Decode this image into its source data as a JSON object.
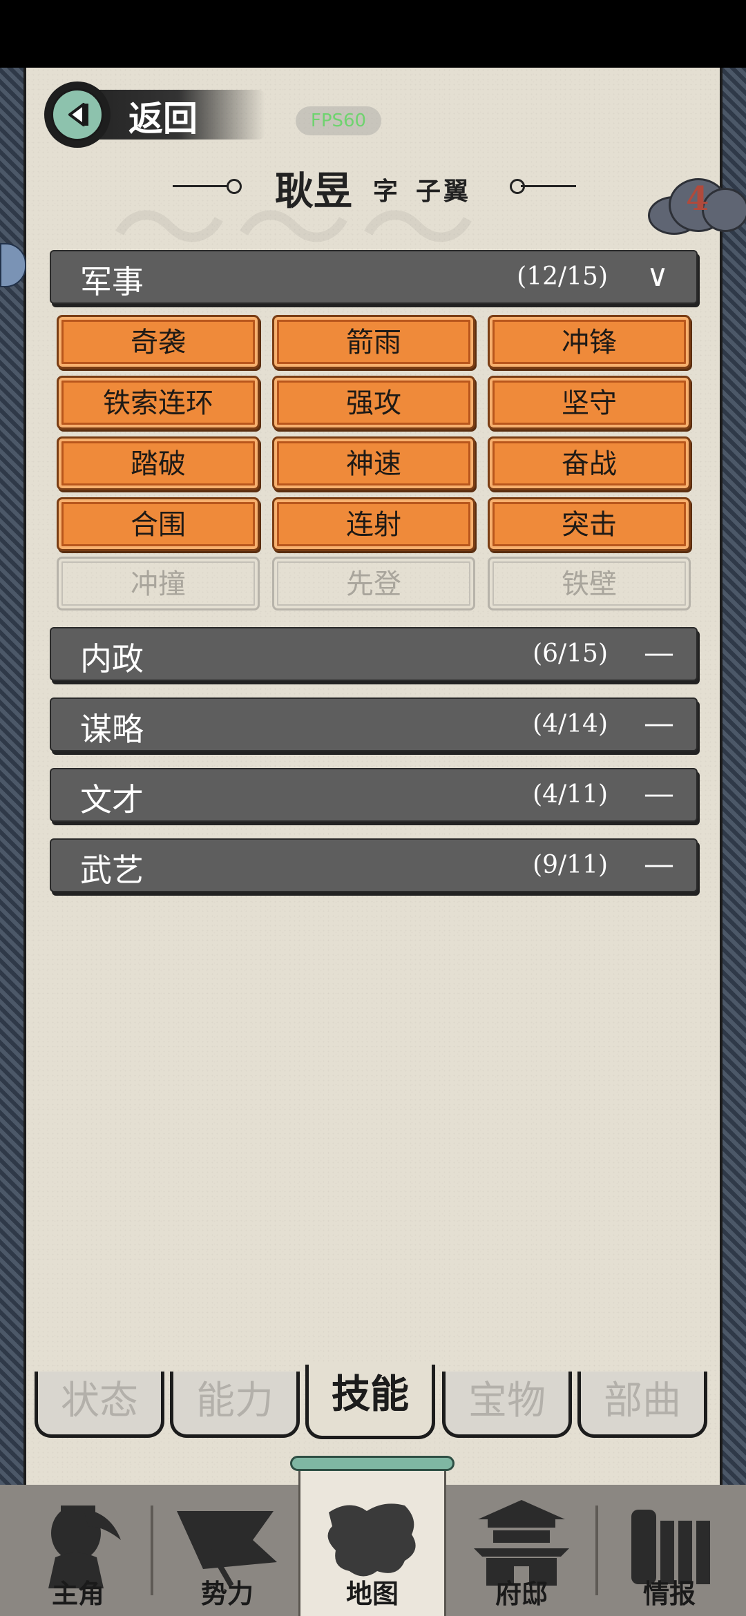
{
  "header": {
    "back_label": "返回",
    "fps": "FPS60",
    "character_name": "耿昱",
    "courtesy_label": "字",
    "courtesy_name": "子翼",
    "badge_count": "4"
  },
  "sections": [
    {
      "label": "军事",
      "count": "(12/15)",
      "expanded": true,
      "skills": [
        {
          "name": "奇袭",
          "unlocked": true
        },
        {
          "name": "箭雨",
          "unlocked": true
        },
        {
          "name": "冲锋",
          "unlocked": true
        },
        {
          "name": "铁索连环",
          "unlocked": true
        },
        {
          "name": "强攻",
          "unlocked": true
        },
        {
          "name": "坚守",
          "unlocked": true
        },
        {
          "name": "踏破",
          "unlocked": true
        },
        {
          "name": "神速",
          "unlocked": true
        },
        {
          "name": "奋战",
          "unlocked": true
        },
        {
          "name": "合围",
          "unlocked": true
        },
        {
          "name": "连射",
          "unlocked": true
        },
        {
          "name": "突击",
          "unlocked": true
        },
        {
          "name": "冲撞",
          "unlocked": false
        },
        {
          "name": "先登",
          "unlocked": false
        },
        {
          "name": "铁壁",
          "unlocked": false
        }
      ]
    },
    {
      "label": "内政",
      "count": "(6/15)",
      "expanded": false
    },
    {
      "label": "谋略",
      "count": "(4/14)",
      "expanded": false
    },
    {
      "label": "文才",
      "count": "(4/11)",
      "expanded": false
    },
    {
      "label": "武艺",
      "count": "(9/11)",
      "expanded": false
    }
  ],
  "toggle_icons": {
    "expanded": "∨",
    "collapsed": "—"
  },
  "tabs": [
    {
      "label": "状态",
      "active": false
    },
    {
      "label": "能力",
      "active": false
    },
    {
      "label": "技能",
      "active": true
    },
    {
      "label": "宝物",
      "active": false
    },
    {
      "label": "部曲",
      "active": false
    }
  ],
  "nav": [
    {
      "label": "主角",
      "icon": "warrior-icon",
      "active": false
    },
    {
      "label": "势力",
      "icon": "flag-icon",
      "active": false
    },
    {
      "label": "地图",
      "icon": "map-icon",
      "active": true
    },
    {
      "label": "府邸",
      "icon": "mansion-icon",
      "active": false
    },
    {
      "label": "情报",
      "icon": "scroll-icon",
      "active": false
    }
  ],
  "colors": {
    "skill_on": "#ef8a3a",
    "section_bg": "#5e5e5e",
    "paper": "#e4dfd2",
    "fps_text": "#6fd36f",
    "badge_number": "#b04a3c"
  }
}
